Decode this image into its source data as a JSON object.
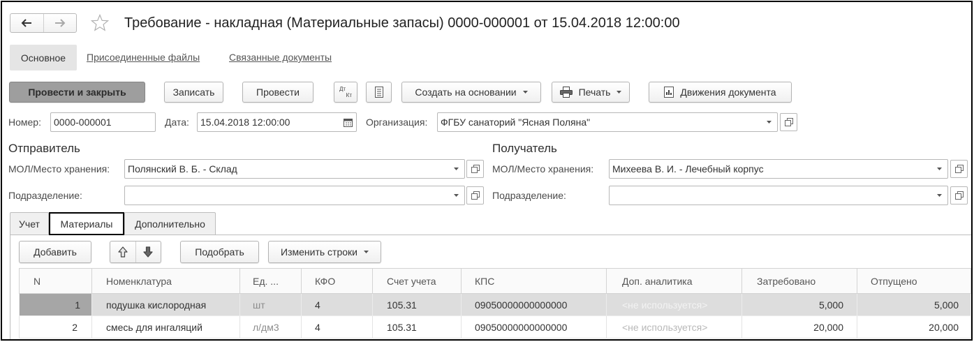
{
  "window": {
    "title": "Требование - накладная (Материальные запасы) 0000-000001 от 15.04.2018 12:00:00"
  },
  "icons": {
    "back": "arrow-left-icon",
    "forward": "arrow-right-icon",
    "favorite": "star-icon",
    "report": "report-icon",
    "print": "printer-icon",
    "movements": "document-movements-icon",
    "calendar": "calendar-icon",
    "dropdown": "chevron-down-icon",
    "open": "open-icon",
    "move_up": "arrow-up-icon",
    "move_down": "arrow-down-icon"
  },
  "nav": {
    "tabs": [
      {
        "label": "Основное",
        "active": true
      },
      {
        "label": "Присоединенные файлы",
        "active": false
      },
      {
        "label": "Связанные документы",
        "active": false
      }
    ]
  },
  "toolbar": {
    "post_and_close": "Провести и закрыть",
    "save": "Записать",
    "post": "Провести",
    "dt": "Дт",
    "kt": "Кт",
    "create_based_on": "Создать на основании",
    "print": "Печать",
    "movements": "Движения документа"
  },
  "header": {
    "number": {
      "label": "Номер:",
      "value": "0000-000001"
    },
    "date": {
      "label": "Дата:",
      "value": "15.04.2018 12:00:00"
    },
    "organization": {
      "label": "Организация:",
      "value": "ФГБУ санаторий \"Ясная Поляна\""
    }
  },
  "sender": {
    "heading": "Отправитель",
    "storage": {
      "label": "МОЛ/Место хранения:",
      "value": "Полянский В. Б. - Склад"
    },
    "department": {
      "label": "Подразделение:",
      "value": ""
    }
  },
  "receiver": {
    "heading": "Получатель",
    "storage": {
      "label": "МОЛ/Место хранения:",
      "value": "Михеева В. И. - Лечебный корпус"
    },
    "department": {
      "label": "Подразделение:",
      "value": ""
    }
  },
  "form_tabs": [
    {
      "label": "Учет",
      "active": false
    },
    {
      "label": "Материалы",
      "active": true
    },
    {
      "label": "Дополнительно",
      "active": false
    }
  ],
  "materials": {
    "toolbar": {
      "add": "Добавить",
      "pick": "Подобрать",
      "change_rows": "Изменить строки"
    },
    "columns": [
      "N",
      "Номенклатура",
      "Ед. ...",
      "КФО",
      "Счет учета",
      "КПС",
      "Доп. аналитика",
      "Затребовано",
      "Отпущено"
    ],
    "rows": [
      {
        "n": "1",
        "item": "подушка кислородная",
        "unit": "шт",
        "kfo": "4",
        "account": "105.31",
        "kps": "09050000000000000",
        "analytics": "<не используется>",
        "requested": "5,000",
        "released": "5,000",
        "selected": true
      },
      {
        "n": "2",
        "item": "смесь для ингаляций",
        "unit": "л/дм3",
        "kfo": "4",
        "account": "105.31",
        "kps": "09050000000000000",
        "analytics": "<не используется>",
        "requested": "20,000",
        "released": "20,000",
        "selected": false
      }
    ]
  },
  "colors": {
    "primary_button": "#9e9e9e",
    "active_tab": "#e5e5e5",
    "selected_row": "#dddddd",
    "selected_row_marker": "#a6a6a6",
    "highlight_border": "#000000"
  }
}
